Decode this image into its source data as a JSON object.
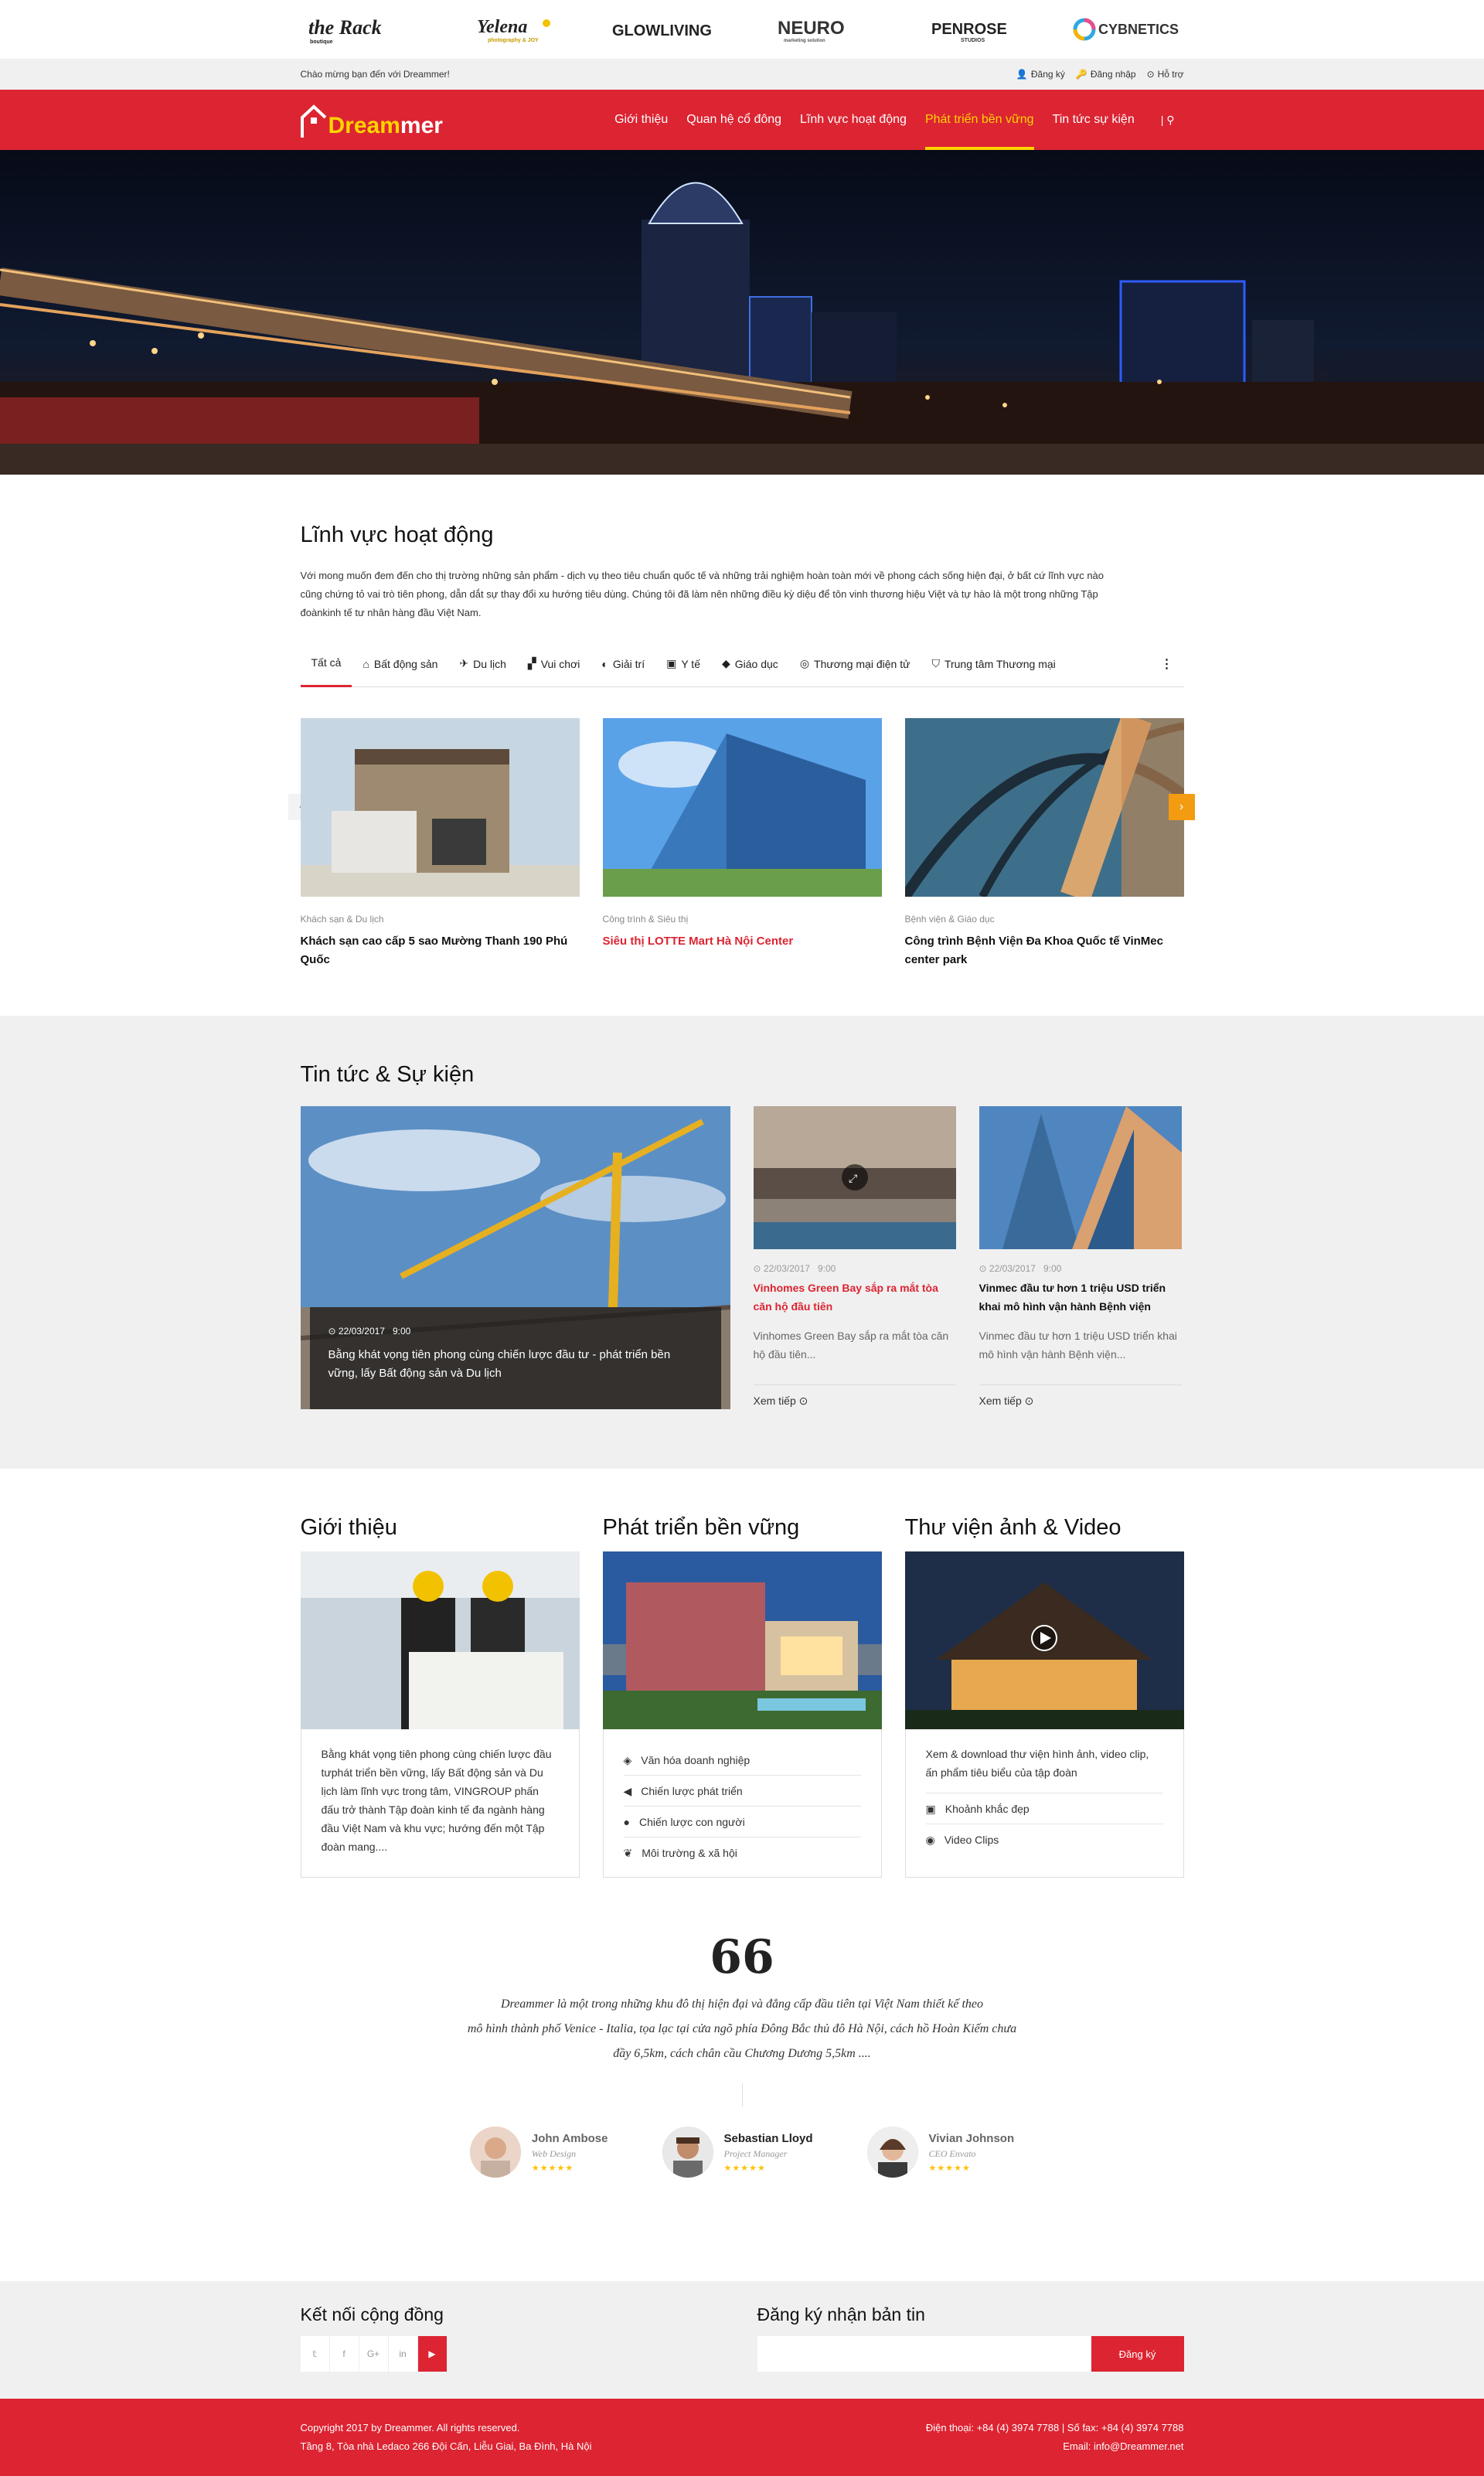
{
  "brands": [
    "the Rack",
    "Yelena",
    "GLOWLIVING",
    "NEURO",
    "PENROSE",
    "CYBNETICS"
  ],
  "brand_subs": {
    "rack": "boutique",
    "yelena": "photography & JOY",
    "neuro": "marketing solution",
    "penrose": "STUDIOS"
  },
  "topbar": {
    "welcome": "Chào mừng bạn đến với Dreammer!",
    "register": "Đăng ký",
    "login": "Đăng nhập",
    "support": "Hỗ trợ"
  },
  "logo": {
    "part1": "Dream",
    "part2": "mer"
  },
  "menu": [
    "Giới thiệu",
    "Quan hệ cổ đông",
    "Lĩnh vực hoạt động",
    "Phát triển bền vững",
    "Tin tức sự kiện"
  ],
  "menu_active_index": 3,
  "colors": {
    "primary": "#dc2432",
    "accent": "#ffd400",
    "orange": "#f39c12"
  },
  "activities": {
    "title": "Lĩnh vực hoạt động",
    "intro": "Với mong muốn đem đến cho thị trường những sản phẩm - dịch vụ theo tiêu chuẩn quốc tế và những trải nghiệm hoàn toàn mới về phong cách sống hiện đại, ở bất cứ lĩnh vực nào  cũng chứng tỏ vai trò tiên phong, dẫn dắt sự thay đổi xu hướng tiêu dùng. Chúng tôi đã làm nên những điều kỳ diệu để tôn vinh thương hiệu Việt và tự hào là một trong những Tập đoànkinh tế tư nhân hàng đầu Việt Nam.",
    "tabs": [
      "Tất cả",
      "Bất động sản",
      "Du lịch",
      "Vui chơi",
      "Giải trí",
      "Y tế",
      "Giáo dục",
      "Thương mại điện tử",
      "Trung tâm Thương mại"
    ],
    "tab_icons": [
      "",
      "home-icon",
      "plane-icon",
      "puzzle-icon",
      "music-icon",
      "medkit-icon",
      "graduation-icon",
      "globe-icon",
      "shield-icon"
    ],
    "more": "⋮",
    "cards": [
      {
        "cat": "Khách sạn & Du lịch",
        "title": "Khách sạn cao cấp 5 sao Mường Thanh 190 Phú Quốc"
      },
      {
        "cat": "Công trình & Siêu thị",
        "title": "Siêu thị LOTTE Mart Hà Nội Center"
      },
      {
        "cat": "Bệnh viện & Giáo dục",
        "title": "Công trình Bệnh Viện Đa Khoa Quốc tế VinMec center park"
      }
    ]
  },
  "news": {
    "title": "Tin tức & Sự kiện",
    "big": {
      "date": "22/03/2017",
      "time": "9:00",
      "text": "Bằng khát vọng tiên phong cùng chiến lược đầu tư - phát triển bền vững, lấy Bất động sản và Du lịch"
    },
    "items": [
      {
        "date": "22/03/2017",
        "time": "9:00",
        "title": "Vinhomes Green Bay sắp ra mắt tòa căn hộ đầu tiên",
        "excerpt": "Vinhomes Green Bay sắp ra mắt tòa căn hộ đầu tiên...",
        "more": "Xem tiếp"
      },
      {
        "date": "22/03/2017",
        "time": "9:00",
        "title": "Vinmec đầu tư hơn 1 triệu USD triển khai mô hình vận hành Bệnh viện",
        "excerpt": "Vinmec đầu tư hơn 1 triệu USD triển khai mô hình vận hành Bệnh viện...",
        "more": "Xem tiếp"
      }
    ]
  },
  "about": {
    "title": "Giới thiệu",
    "text": "Bằng khát vọng tiên phong cùng chiến lược đầu tưphát triển bền vững, lấy Bất động sản và Du lịch làm lĩnh vực trong tâm, VINGROUP phấn đấu trở thành Tập đoàn kinh tế đa ngành hàng đầu Việt Nam và khu vực; hướng đến một Tập đoàn mang...."
  },
  "sustain": {
    "title": "Phát triển bền vững",
    "items": [
      "Văn hóa doanh nghiệp",
      "Chiến lược phát triển",
      "Chiến lược con người",
      "Môi trường & xã hội"
    ]
  },
  "gallery": {
    "title": "Thư viện ảnh & Video",
    "text": "Xem & download thư viện hình ảnh, video clip, ấn phẩm tiêu biểu của tập đoàn",
    "items": [
      "Khoảnh khắc đẹp",
      "Video Clips"
    ]
  },
  "quote": {
    "mark": "66",
    "line1": "Dreammer là một trong những khu đô thị hiện đại và đẳng cấp đầu tiên tại Việt Nam thiết kế theo",
    "line2": "mô hình thành phố Venice - Italia, tọa lạc tại cửa ngõ phía Đông Bắc thủ đô Hà Nội, cách hồ Hoàn Kiếm chưa",
    "line3": "đầy 6,5km, cách chân cầu Chương Dương 5,5km ...."
  },
  "testimonials": [
    {
      "name": "John Ambose",
      "role": "Web Design",
      "rating": 5
    },
    {
      "name": "Sebastian Lloyd",
      "role": "Project Manager",
      "rating": 5
    },
    {
      "name": "Vivian Johnson",
      "role": "CEO Envato",
      "rating": 5
    }
  ],
  "community": {
    "title": "Kết nối cộng đồng",
    "icons": [
      "twitter-icon",
      "facebook-icon",
      "google-plus-icon",
      "linkedin-icon",
      "youtube-icon"
    ],
    "labels": [
      "𝕥",
      "f",
      "G+",
      "in",
      "▶"
    ]
  },
  "newsletter": {
    "title": "Đăng ký nhận bản tin",
    "placeholder": "",
    "button": "Đăng ký"
  },
  "footer": {
    "copyright": "Copyright 2017 by Dreammer. All rights reserved.",
    "address": "Tầng 8, Tòa nhà Ledaco 266 Đội Cấn, Liễu Giai, Ba Đình, Hà Nội",
    "phone": "Điện thoại: +84 (4) 3974 7788 | Số fax: +84 (4) 3974 7788",
    "email": "Email: info@Dreammer.net"
  }
}
